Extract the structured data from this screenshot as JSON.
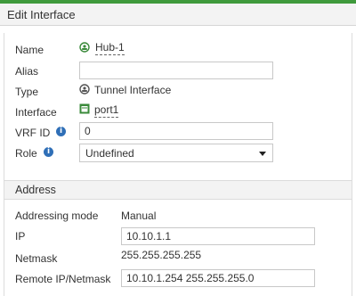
{
  "dialog": {
    "title": "Edit Interface"
  },
  "fields": {
    "name": {
      "label": "Name",
      "value": "Hub-1"
    },
    "alias": {
      "label": "Alias",
      "value": ""
    },
    "type": {
      "label": "Type",
      "value": "Tunnel Interface"
    },
    "interface": {
      "label": "Interface",
      "value": "port1"
    },
    "vrf_id": {
      "label": "VRF ID",
      "value": "0"
    },
    "role": {
      "label": "Role",
      "value": "Undefined"
    }
  },
  "address": {
    "title": "Address",
    "addressing_mode": {
      "label": "Addressing mode",
      "value": "Manual"
    },
    "ip": {
      "label": "IP",
      "value": "10.10.1.1"
    },
    "netmask": {
      "label": "Netmask",
      "value": "255.255.255.255"
    },
    "remote_ip": {
      "label": "Remote IP/Netmask",
      "value": "10.10.1.254 255.255.255.0"
    }
  },
  "colors": {
    "accent_bar": "#3f9a3c",
    "info_icon": "#2f6fb7",
    "port_icon": "#3a8a3a"
  },
  "icons": {
    "name": "tunnel-icon",
    "type": "tunnel-icon",
    "interface": "port-icon",
    "info": "info-icon",
    "dropdown": "chevron-down-icon"
  }
}
